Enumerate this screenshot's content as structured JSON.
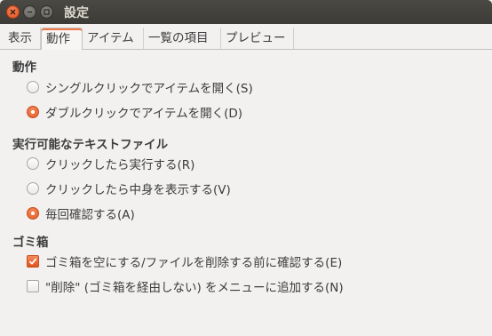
{
  "window": {
    "title": "設定",
    "controls": [
      "close-icon",
      "minimize-icon",
      "maximize-icon"
    ]
  },
  "tabs": [
    {
      "label": "表示",
      "active": false
    },
    {
      "label": "動作",
      "active": true
    },
    {
      "label": "アイテム",
      "active": false
    },
    {
      "label": "一覧の項目",
      "active": false
    },
    {
      "label": "プレビュー",
      "active": false
    }
  ],
  "sections": {
    "behavior": {
      "title": "動作",
      "options": [
        {
          "label": "シングルクリックでアイテムを開く(S)",
          "selected": false
        },
        {
          "label": "ダブルクリックでアイテムを開く(D)",
          "selected": true
        }
      ]
    },
    "executable": {
      "title": "実行可能なテキストファイル",
      "options": [
        {
          "label": "クリックしたら実行する(R)",
          "selected": false
        },
        {
          "label": "クリックしたら中身を表示する(V)",
          "selected": false
        },
        {
          "label": "毎回確認する(A)",
          "selected": true
        }
      ]
    },
    "trash": {
      "title": "ゴミ箱",
      "options": [
        {
          "label": "ゴミ箱を空にする/ファイルを削除する前に確認する(E)",
          "checked": true
        },
        {
          "label": "\"削除\" (ゴミ箱を経由しない) をメニューに追加する(N)",
          "checked": false
        }
      ]
    }
  },
  "colors": {
    "accent": "#e35b22",
    "titlebar": "#3c3b37",
    "background": "#f2f1f0"
  }
}
